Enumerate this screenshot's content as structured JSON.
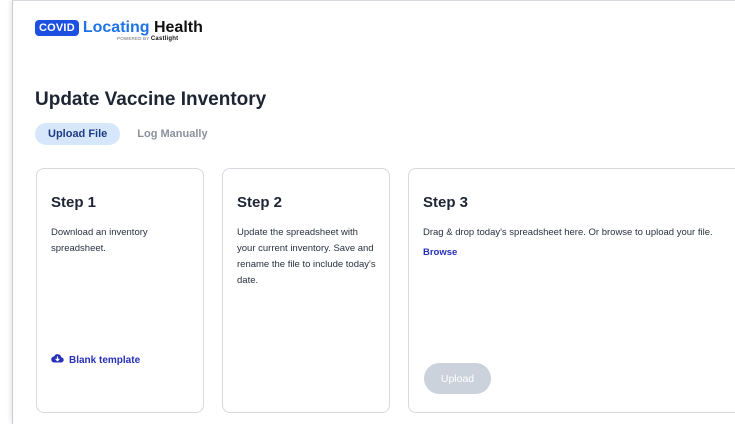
{
  "brand": {
    "badge": "COVID",
    "name_part1": "Locating",
    "name_part2": "Health",
    "powered_prefix": "POWERED BY",
    "powered_brand": "Castlight"
  },
  "page": {
    "title": "Update Vaccine Inventory"
  },
  "tabs": [
    {
      "label": "Upload File",
      "active": true
    },
    {
      "label": "Log Manually",
      "active": false
    }
  ],
  "steps": [
    {
      "title": "Step 1",
      "description": "Download an inventory spreadsheet.",
      "action_label": "Blank template",
      "action_icon": "cloud-download-icon"
    },
    {
      "title": "Step 2",
      "description": "Update the spreadsheet with your current inventory. Save and rename the file to include today's date."
    },
    {
      "title": "Step 3",
      "description": "Drag & drop today's spreadsheet here. Or browse to upload your file.",
      "browse_label": "Browse",
      "upload_label": "Upload",
      "upload_enabled": false
    }
  ],
  "colors": {
    "brand_blue": "#1d4fe0",
    "link": "#2630b8",
    "tab_active_bg": "#d7e7fb",
    "disabled_button": "#cbd2dc"
  }
}
